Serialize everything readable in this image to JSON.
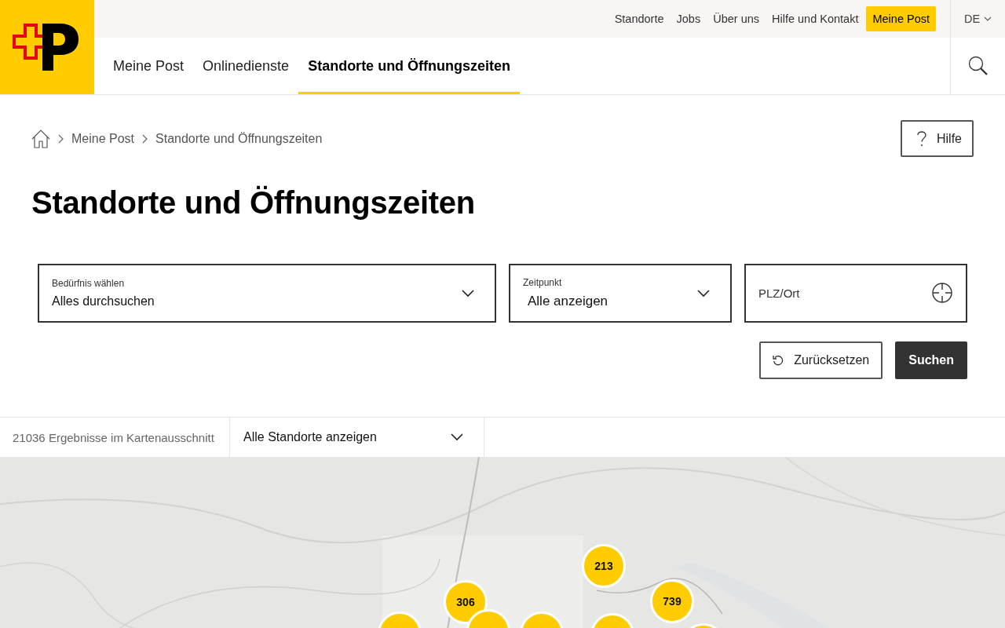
{
  "top_links": [
    {
      "label": "Standorte",
      "highlighted": false
    },
    {
      "label": "Jobs",
      "highlighted": false
    },
    {
      "label": "Über uns",
      "highlighted": false
    },
    {
      "label": "Hilfe und Kontakt",
      "highlighted": false
    },
    {
      "label": "Meine Post",
      "highlighted": true
    }
  ],
  "language": "DE",
  "nav": [
    {
      "label": "Meine Post",
      "selected": false
    },
    {
      "label": "Onlinedienste",
      "selected": false
    },
    {
      "label": "Standorte und Öffnungszeiten",
      "selected": true
    }
  ],
  "breadcrumb": [
    "Meine Post",
    "Standorte und Öffnungszeiten"
  ],
  "help_button": "Hilfe",
  "title": "Standorte und Öffnungszeiten",
  "filters": [
    {
      "kind": "select",
      "label": "Bedürfnis wählen",
      "value": "Alles durchsuchen"
    },
    {
      "kind": "select",
      "label": "Zeitpunkt",
      "value": "Alle anzeigen"
    },
    {
      "kind": "location",
      "placeholder": "PLZ/Ort"
    }
  ],
  "reset_button": "Zurücksetzen",
  "search_button": "Suchen",
  "results": {
    "count": "21036 Ergebnisse im Kartenausschnitt",
    "select": "Alle Standorte anzeigen"
  },
  "map": {
    "kind": "picture",
    "markers": [
      {
        "kind": "labeled",
        "label": "213"
      },
      {
        "kind": "labeled",
        "label": "306"
      },
      {
        "kind": "labeled",
        "label": "739"
      },
      {
        "kind": "cut"
      },
      {
        "kind": "cut"
      },
      {
        "kind": "cut"
      },
      {
        "kind": "cut"
      },
      {
        "kind": "cut"
      }
    ]
  }
}
